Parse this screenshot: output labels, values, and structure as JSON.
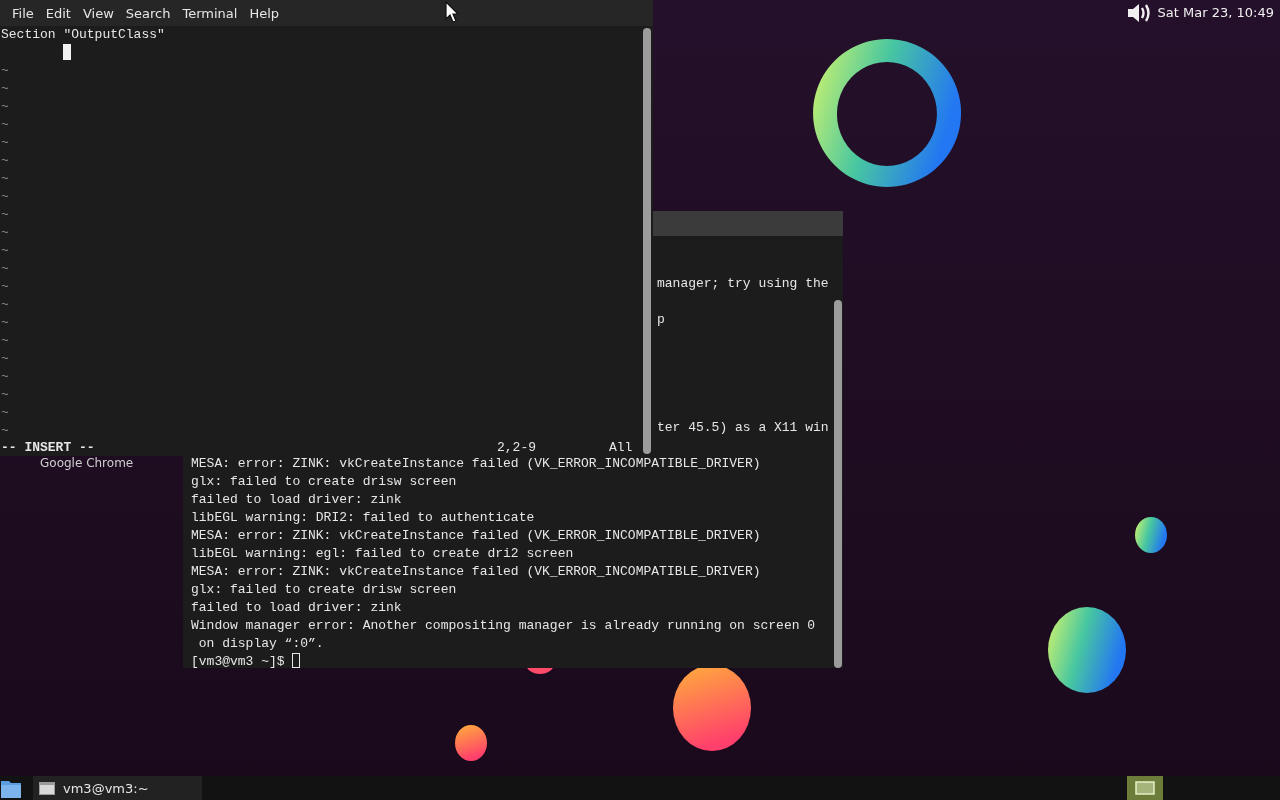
{
  "top_panel": {
    "clock": "Sat Mar 23, 10:49"
  },
  "desktop_icons": [
    {
      "label": "Google Chrome"
    }
  ],
  "terminal_window": {
    "partial_lines": [
      "manager; try using the",
      "p",
      "ter 45.5) as a X11 win"
    ],
    "lines": [
      "MESA: error: ZINK: vkCreateInstance failed (VK_ERROR_INCOMPATIBLE_DRIVER)",
      "glx: failed to create drisw screen",
      "failed to load driver: zink",
      "libEGL warning: DRI2: failed to authenticate",
      "MESA: error: ZINK: vkCreateInstance failed (VK_ERROR_INCOMPATIBLE_DRIVER)",
      "libEGL warning: egl: failed to create dri2 screen",
      "MESA: error: ZINK: vkCreateInstance failed (VK_ERROR_INCOMPATIBLE_DRIVER)",
      "glx: failed to create drisw screen",
      "failed to load driver: zink",
      "Window manager error: Another compositing manager is already running on screen 0",
      " on display “:0”."
    ],
    "prompt": "[vm3@vm3 ~]$ "
  },
  "vim_window": {
    "menu": [
      "File",
      "Edit",
      "View",
      "Search",
      "Terminal",
      "Help"
    ],
    "lines": [
      "Section \"OutputClass\""
    ],
    "empty_line_marks": [
      "~",
      "~",
      "~",
      "~",
      "~",
      "~",
      "~",
      "~",
      "~",
      "~",
      "~",
      "~",
      "~",
      "~",
      "~",
      "~",
      "~",
      "~",
      "~",
      "~",
      "~"
    ],
    "status": {
      "mode": "-- INSERT --",
      "position": "2,2-9",
      "scroll": "All"
    }
  },
  "taskbar": {
    "tasks": [
      {
        "label": "vm3@vm3:~"
      }
    ]
  }
}
